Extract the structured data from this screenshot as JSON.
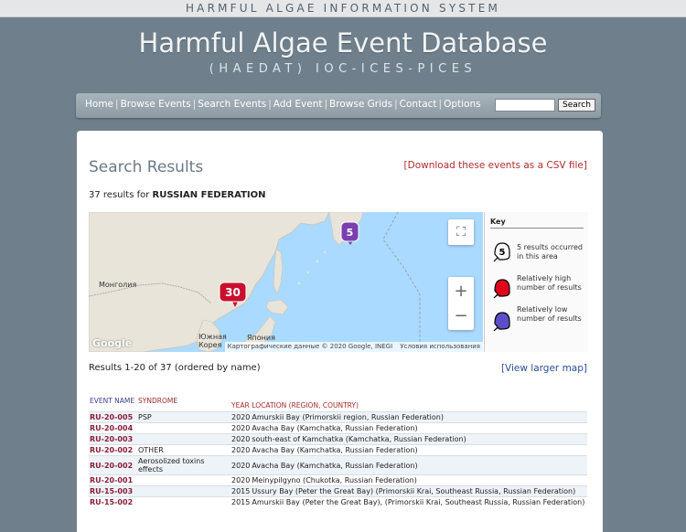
{
  "header": {
    "system_name": "HARMFUL ALGAE INFORMATION SYSTEM",
    "title": "Harmful Algae Event Database",
    "subtitle": "(HAEDAT) IOC-ICES-PICES"
  },
  "nav": {
    "items": [
      "Home",
      "Browse Events",
      "Search Events",
      "Add Event",
      "Browse Grids",
      "Contact",
      "Options"
    ],
    "search_value": "",
    "search_button": "Search"
  },
  "page": {
    "heading": "Search Results",
    "csv_link": "[Download these events as a CSV file]",
    "results_count_prefix": "37 results for",
    "results_country": "RUSSIAN FEDERATION",
    "results_range": "Results 1-20 of 37 (ordered by name)",
    "larger_map_link": "[View larger map]"
  },
  "map": {
    "labels": {
      "mongolia": "Монголия",
      "korea": "Южная Корея",
      "japan": "Япония"
    },
    "attribution_data": "Картографические данные © 2020 Google, INEGI",
    "attribution_terms": "Условия использования",
    "google": "Google",
    "markers": [
      {
        "count": "30",
        "color": "#c8102e"
      },
      {
        "count": "5",
        "color": "#7b3fb0"
      }
    ],
    "buttons": {
      "zoom_in": "+",
      "zoom_out": "−"
    }
  },
  "key": {
    "title": "Key",
    "items": [
      {
        "marker": "5",
        "text": "5 results occurred in this area"
      },
      {
        "marker": "",
        "text": "Relatively high number of results"
      },
      {
        "marker": "",
        "text": "Relatively low number of results"
      }
    ]
  },
  "table": {
    "headers": {
      "event_name": "EVENT NAME",
      "syndrome": "SYNDROME",
      "year": "YEAR",
      "location": "LOCATION (REGION, COUNTRY)"
    },
    "rows": [
      {
        "id": "RU-20-005",
        "syndrome": "PSP",
        "year": "2020",
        "location": "Amurskii Bay (Primorskii region, Russian Federation)"
      },
      {
        "id": "RU-20-004",
        "syndrome": "",
        "year": "2020",
        "location": "Avacha Bay (Kamchatka, Russian Federation)"
      },
      {
        "id": "RU-20-003",
        "syndrome": "",
        "year": "2020",
        "location": "south-east of Kamchatka (Kamchatka, Russian Federation)"
      },
      {
        "id": "RU-20-002",
        "syndrome": "OTHER",
        "year": "2020",
        "location": "Avacha Bay (Kamchatka, Russian Federation)"
      },
      {
        "id": "RU-20-002",
        "syndrome": "Aerosolized toxins effects",
        "year": "2020",
        "location": "Avacha Bay (Kamchatka, Russian Federation)"
      },
      {
        "id": "RU-20-001",
        "syndrome": "",
        "year": "2020",
        "location": "Meinypilgyno (Chukotka, Russian Federation)"
      },
      {
        "id": "RU-15-003",
        "syndrome": "",
        "year": "2015",
        "location": "Ussury Bay (Peter the Great Bay) (Primorskii Krai, Southeast Russia, Russian Federation)"
      },
      {
        "id": "RU-15-002",
        "syndrome": "",
        "year": "2015",
        "location": "Amurskii Bay (Peter the Great Bay), (Primorskii Krai, Southeast Russia, Russian Federation)"
      }
    ]
  }
}
